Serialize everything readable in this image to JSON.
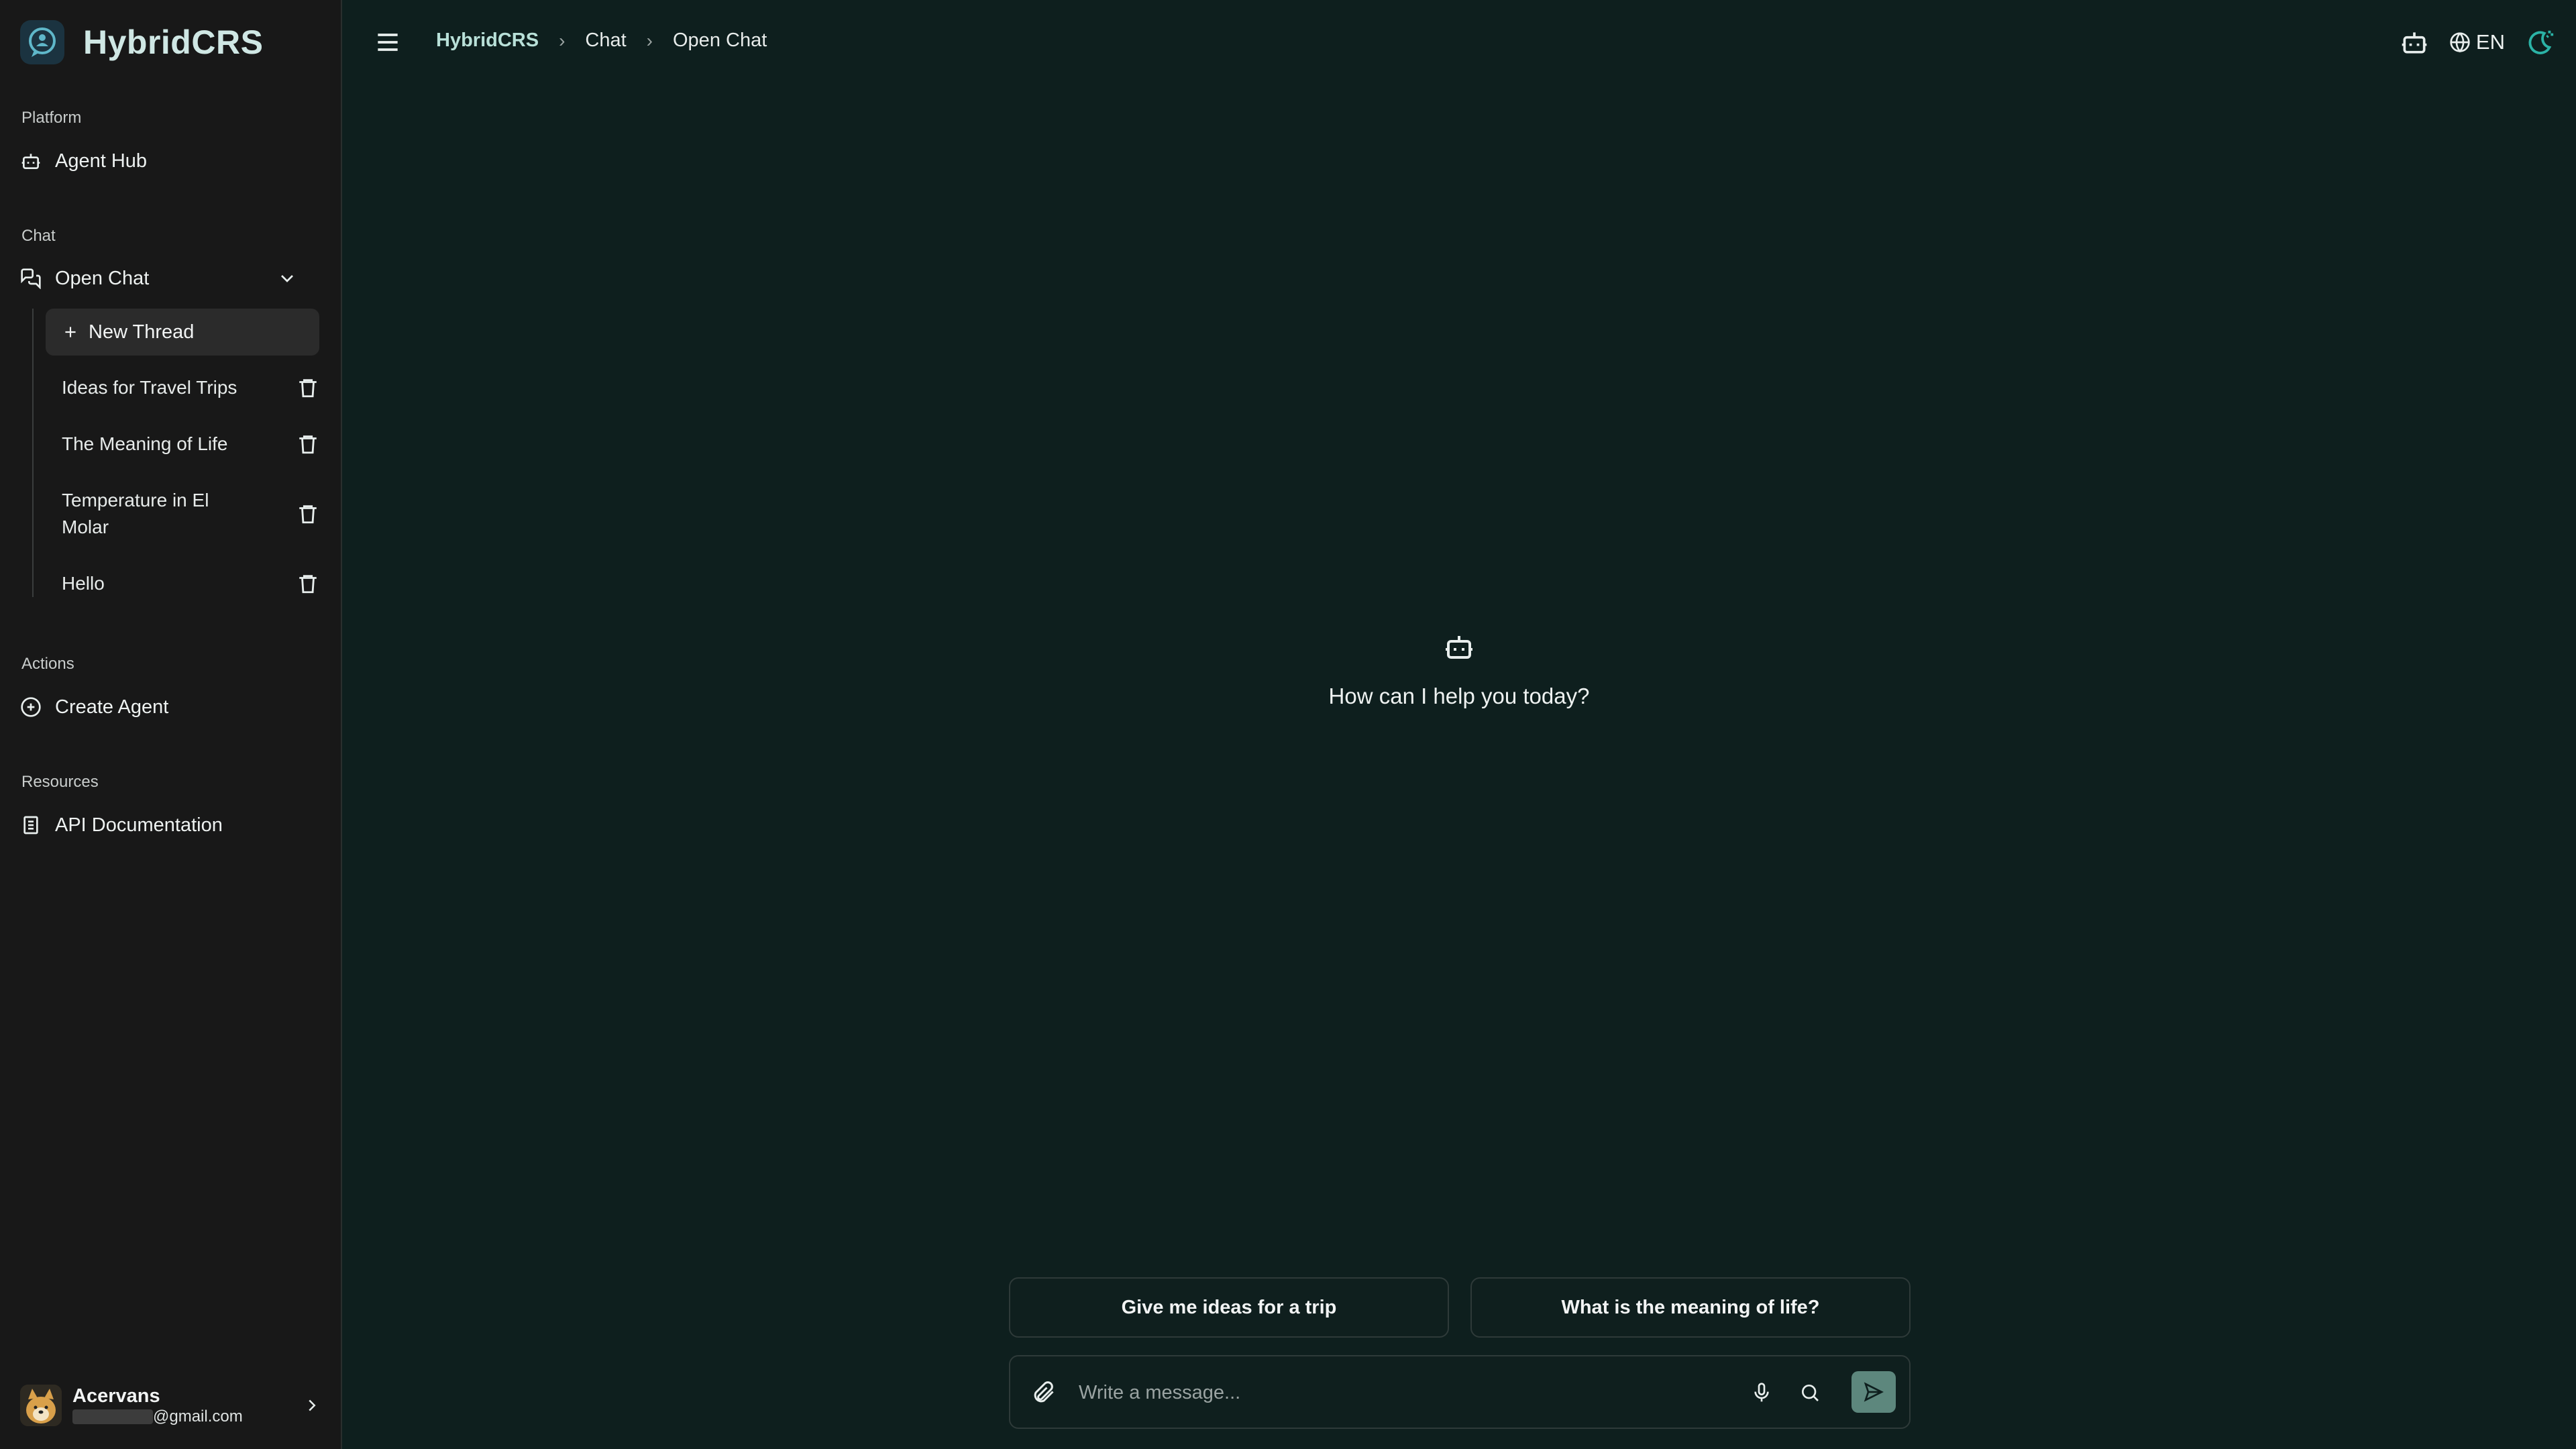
{
  "app": {
    "name": "HybridCRS"
  },
  "sidebar": {
    "sections": {
      "platform": "Platform",
      "chat": "Chat",
      "actions": "Actions",
      "resources": "Resources"
    },
    "items": {
      "agent_hub": "Agent Hub",
      "open_chat": "Open Chat",
      "new_thread": "New Thread",
      "create_agent": "Create Agent",
      "api_docs": "API Documentation"
    },
    "threads": [
      {
        "title": "Ideas for Travel Trips"
      },
      {
        "title": "The Meaning of Life"
      },
      {
        "title": "Temperature in El Molar"
      },
      {
        "title": "Hello"
      }
    ]
  },
  "user": {
    "name": "Acervans",
    "email_suffix": "@gmail.com"
  },
  "header": {
    "breadcrumb": [
      "HybridCRS",
      "Chat",
      "Open Chat"
    ],
    "language": "EN"
  },
  "main": {
    "welcome": "How can I help you today?",
    "suggestions": [
      "Give me ideas for a trip",
      "What is the meaning of life?"
    ],
    "composer_placeholder": "Write a message..."
  },
  "colors": {
    "background": "#0e1f1e",
    "sidebar": "#181818",
    "accent": "#b8e0d8",
    "send_button": "#5d877d",
    "theme_icon": "#2bb3a6"
  }
}
